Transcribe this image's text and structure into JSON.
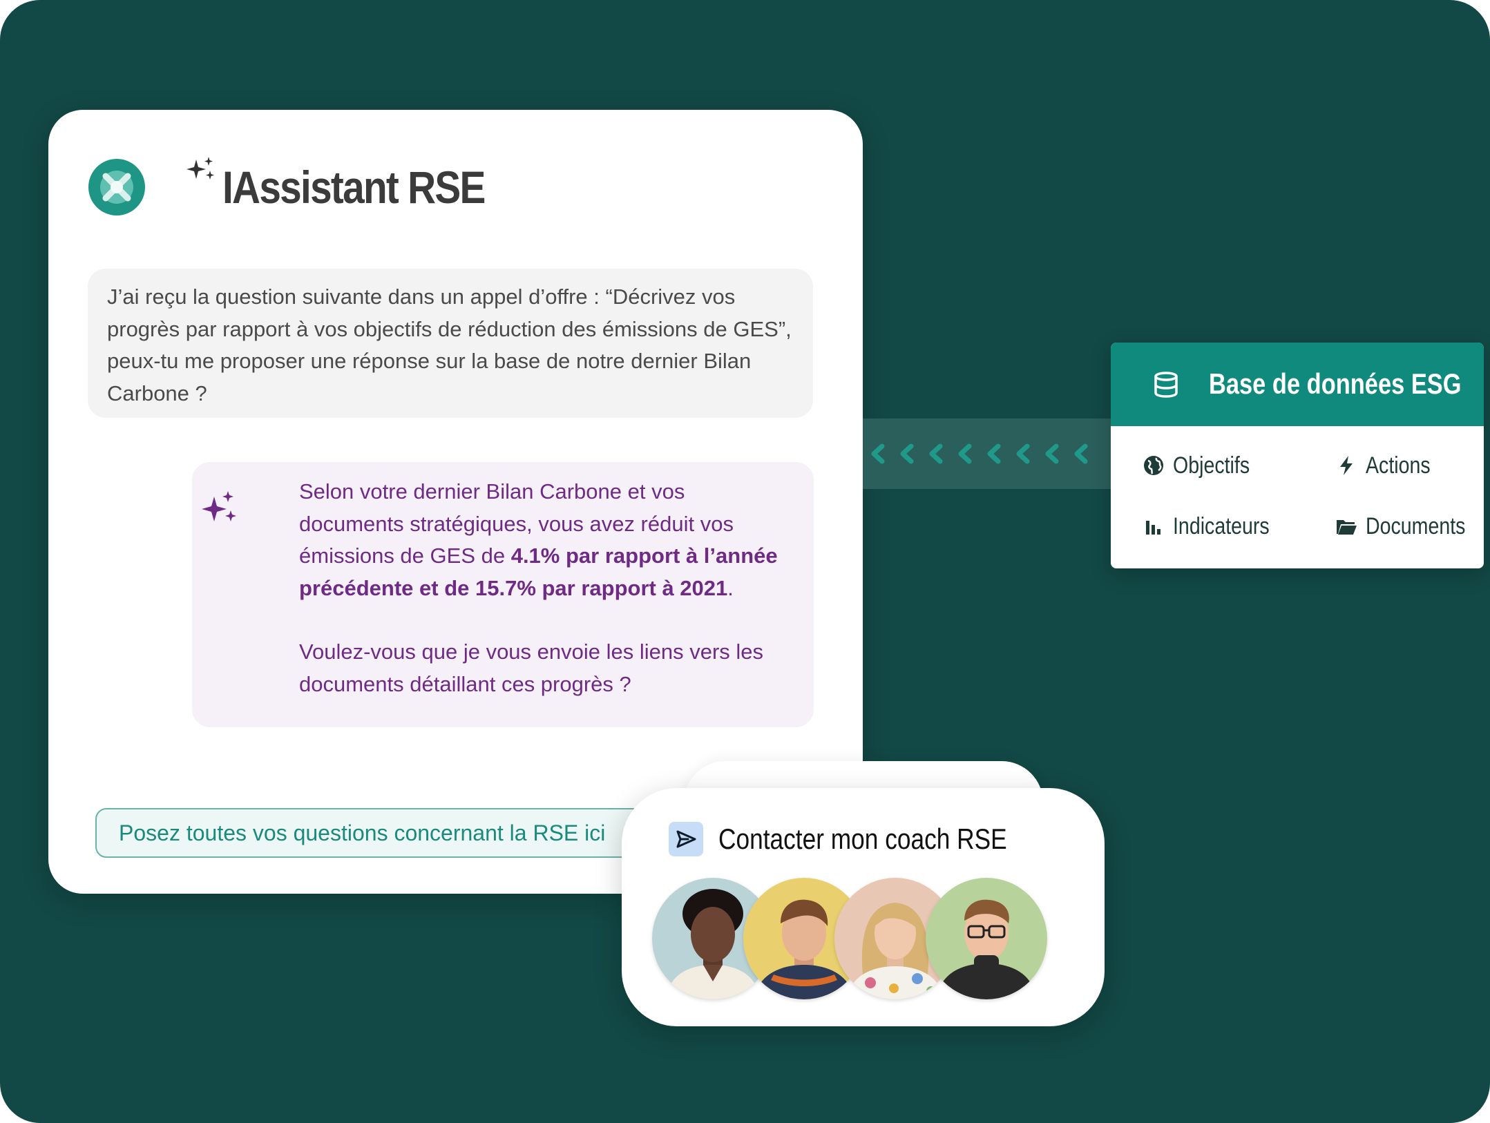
{
  "brand": {
    "title": "IAssistant RSE",
    "logo_icon": "target-logo-icon",
    "sparkle_icon": "sparkle-icon"
  },
  "chat": {
    "user_message": "J’ai reçu la question suivante dans un appel d’offre : “Décrivez vos progrès par rapport à vos objectifs de réduction des émissions de GES”, peux-tu me proposer une réponse sur la base de notre dernier Bilan Carbone ?",
    "assistant_message": {
      "part1": "Selon votre dernier Bilan Carbone et vos documents stratégiques, vous avez réduit vos émissions de GES de ",
      "bold": "4.1% par rapport à l’année précédente et de 15.7% par rapport à 2021",
      "part2": ".",
      "followup": "Voulez-vous que je vous envoie les liens vers les documents détaillant ces progrès ?"
    },
    "input_placeholder": "Posez toutes vos questions concernant la RSE ici"
  },
  "esg_panel": {
    "title": "Base de données ESG",
    "header_icon": "database-icon",
    "items": [
      {
        "label": "Objectifs",
        "icon": "globe-icon"
      },
      {
        "label": "Actions",
        "icon": "lightning-icon"
      },
      {
        "label": "Indicateurs",
        "icon": "bar-chart-icon"
      },
      {
        "label": "Documents",
        "icon": "folder-icon"
      }
    ]
  },
  "coach": {
    "label": "Contacter mon coach RSE",
    "icon": "send-icon",
    "avatar_count": 4
  },
  "colors": {
    "background": "#124845",
    "accent_teal": "#0f8a7c",
    "assistant_purple": "#6f2a86"
  }
}
